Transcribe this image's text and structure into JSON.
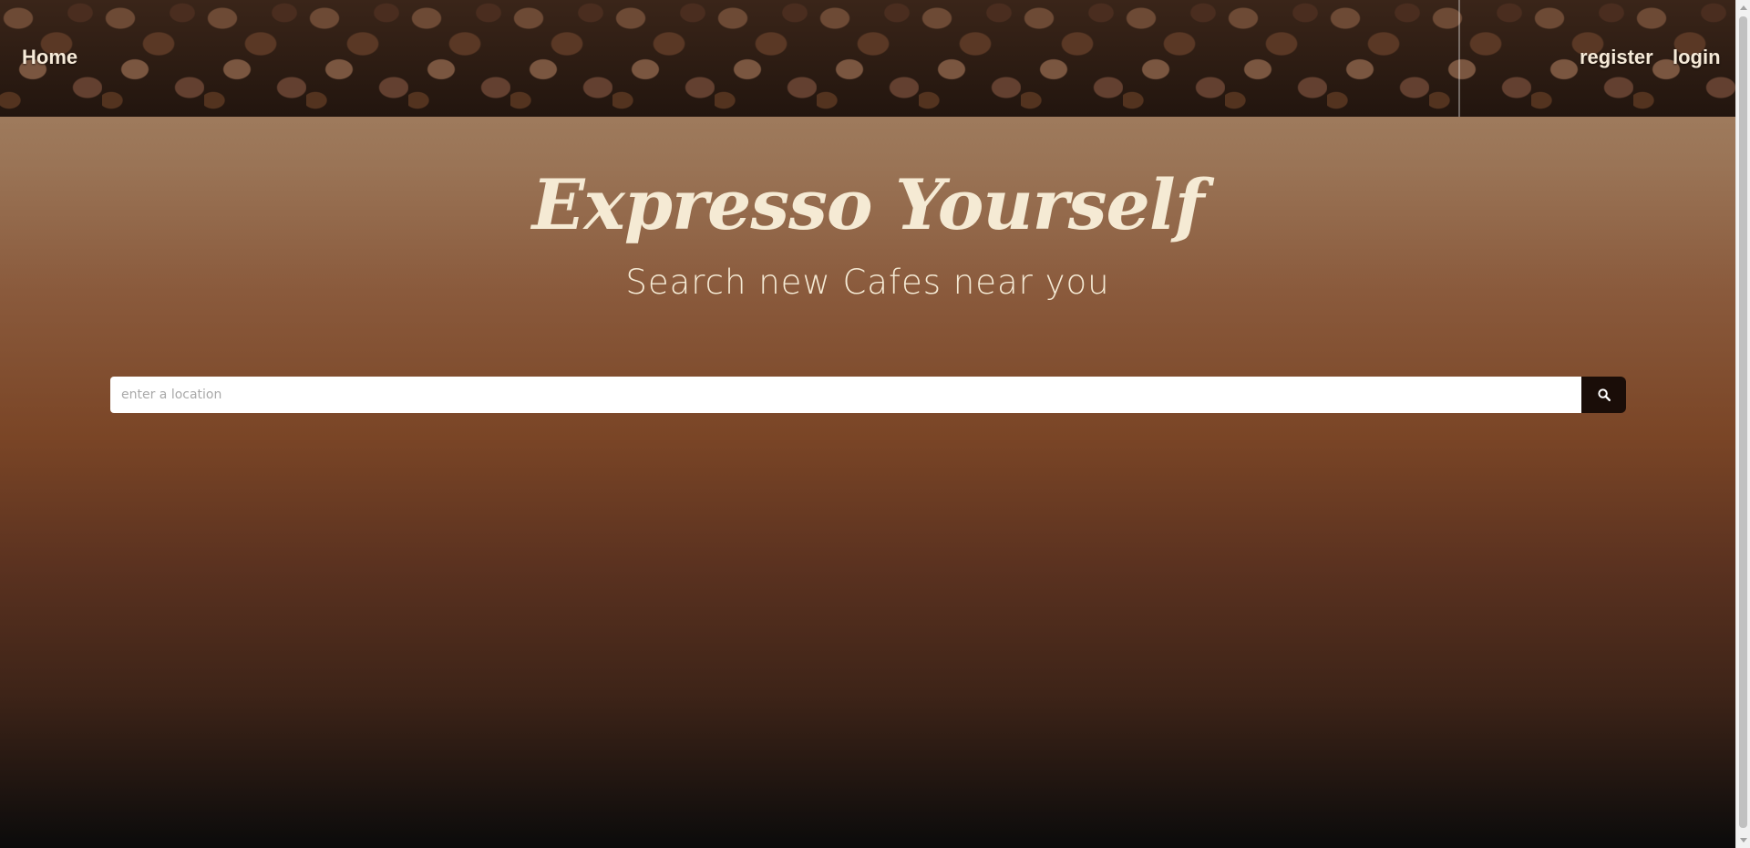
{
  "nav": {
    "home": "Home",
    "register": "register",
    "login": "login"
  },
  "hero": {
    "title": "Expresso Yourself",
    "subtitle": "Search new Cafes near you"
  },
  "search": {
    "placeholder": "enter a location",
    "value": "",
    "button_icon": "search-icon"
  },
  "colors": {
    "header_text": "#f6ead8",
    "hero_text": "#f5ead4",
    "gradient_top": "#a88a6c",
    "gradient_mid": "#7a4526",
    "gradient_bottom": "#0b0b0b",
    "search_button": "#1a0d08"
  }
}
